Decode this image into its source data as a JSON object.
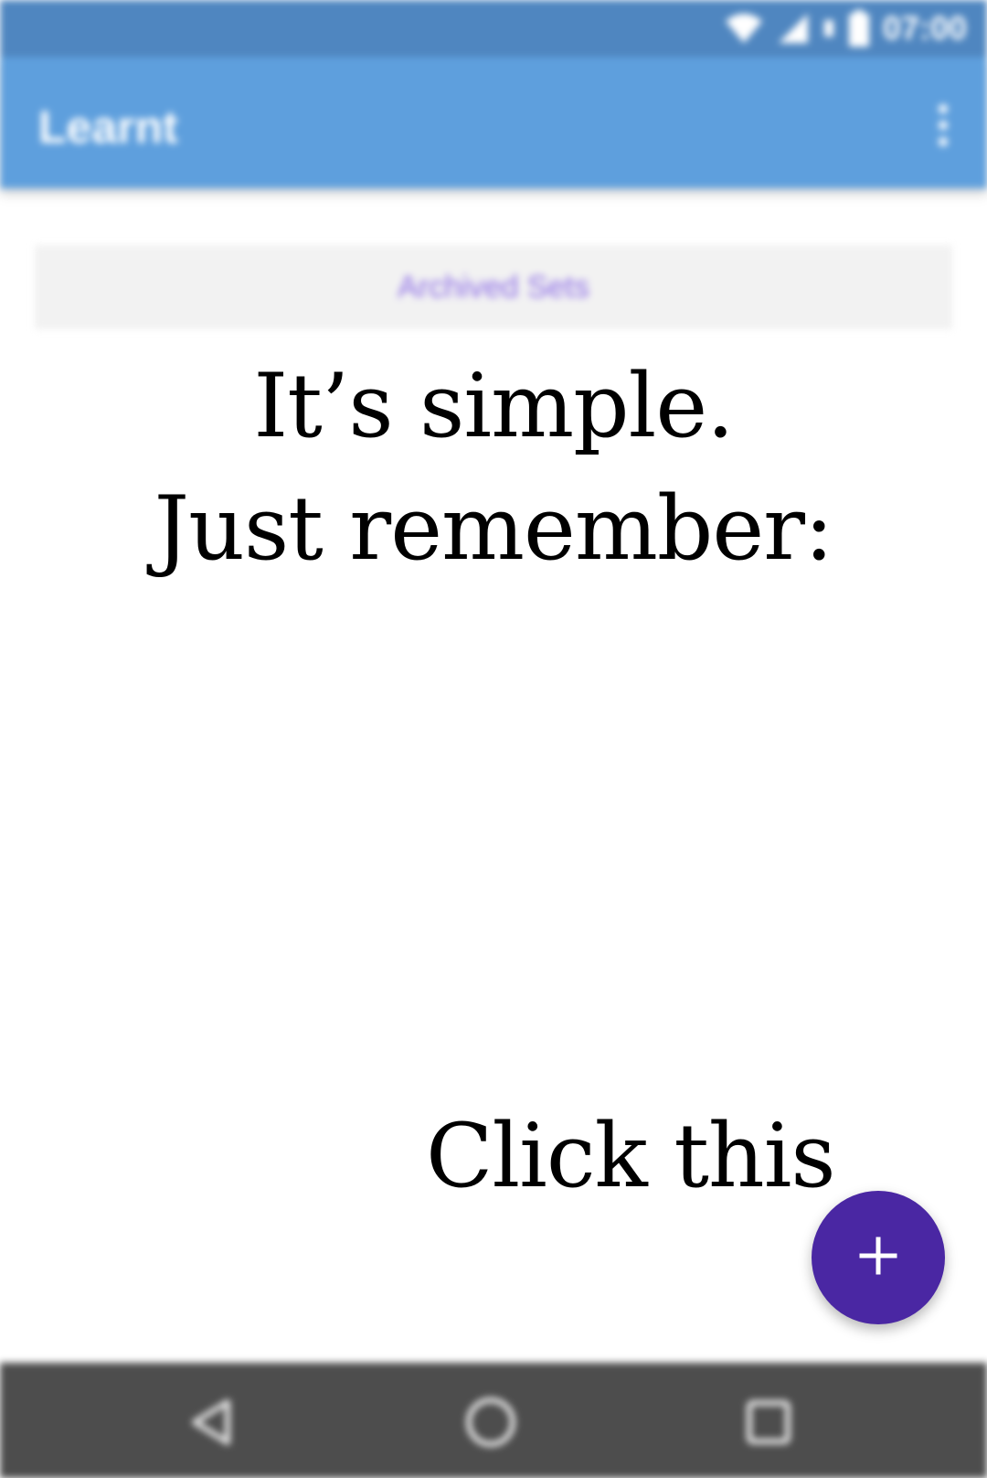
{
  "status_bar": {
    "time": "07:00",
    "icons": [
      "wifi-icon",
      "cell-signal-icon",
      "battery-icon"
    ]
  },
  "app_bar": {
    "title": "Learnt",
    "menu_icon": "overflow-menu-icon"
  },
  "main": {
    "archived_sets_label": "Archived Sets"
  },
  "tutorial": {
    "line1": "It’s simple.",
    "line2": "Just remember:",
    "click_hint": "Click this"
  },
  "fab": {
    "icon": "plus-icon"
  },
  "nav_bar": {
    "icons": [
      "back-icon",
      "home-icon",
      "recents-icon"
    ]
  },
  "colors": {
    "status_bar": "#4f86c0",
    "app_bar": "#5e9fdd",
    "fab": "#4a27a3",
    "archived_label": "#8c6ce6",
    "nav_bar": "#4d4d4d"
  }
}
